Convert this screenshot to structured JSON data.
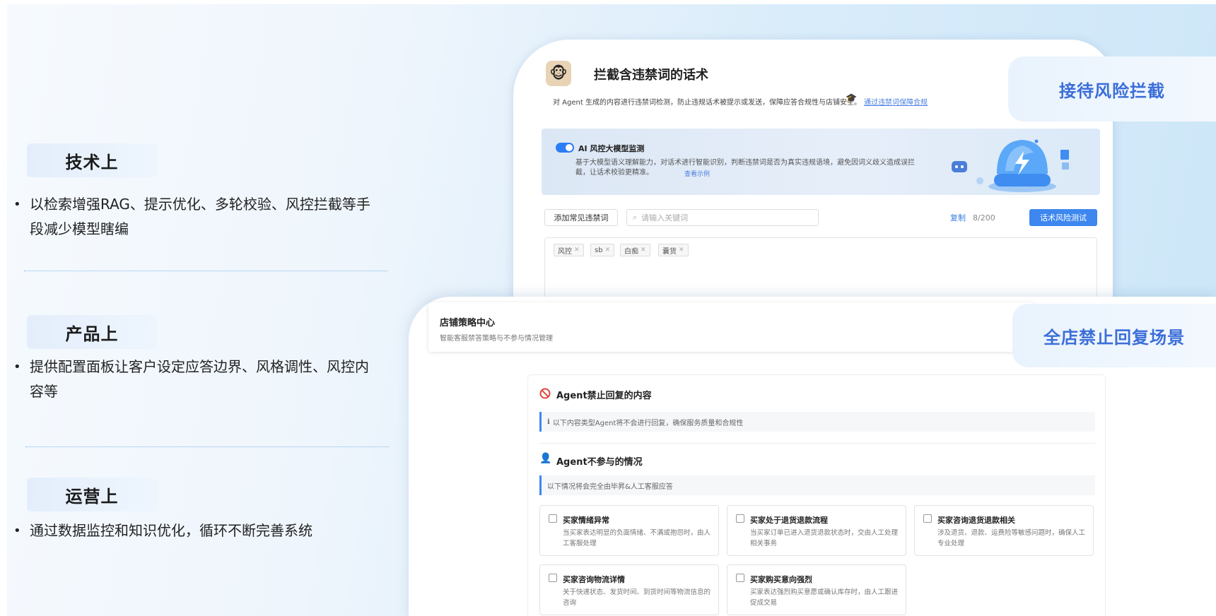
{
  "left": {
    "sections": [
      {
        "title": "技术上",
        "bullet": "以检索增强RAG、提示优化、多轮校验、风控拦截等手段减少模型瞎编"
      },
      {
        "title": "产品上",
        "bullet": "提供配置面板让客户设定应答边界、风格调性、风控内容等"
      },
      {
        "title": "运营上",
        "bullet": "通过数据监控和知识优化，循环不断完善系统"
      }
    ]
  },
  "card1": {
    "avatar_icon": "monkey-avatar",
    "title": "拦截含违禁词的话术",
    "desc": "对 Agent 生成的内容进行违禁词检测，防止违规话术被提示或发送，保障应答合规性与店铺安全。",
    "link": "通过违禁词保障合规",
    "banner": {
      "title": "AI 风控大模型监测",
      "text": "基于大模型语义理解能力，对话术进行智能识别，判断违禁词是否为真实违规语境，避免因词义歧义造成误拦截，让话术校验更精准。",
      "link": "查看示例"
    },
    "toolbar": {
      "add_btn": "添加常见违禁词",
      "search_placeholder": "请输入关键词",
      "copy": "复制",
      "count": "8/200",
      "test_btn": "话术风险测试"
    },
    "tags": [
      "风控",
      "sb",
      "白痴",
      "囊货"
    ]
  },
  "pills": {
    "top": "接待风险拦截",
    "bottom": "全店禁止回复场景"
  },
  "card2": {
    "head_title": "店铺策略中心",
    "head_sub": "智能客服禁答策略与不参与情况管理",
    "section1": {
      "title": "Agent禁止回复的内容",
      "note": "以下内容类型Agent将不会进行回复，确保服务质量和合规性"
    },
    "section2": {
      "title": "Agent不参与的情况",
      "note": "以下情况将会完全由毕昇&人工客服应答"
    },
    "options": [
      {
        "title": "买家情绪异常",
        "desc": "当买家表达明显的负面情绪、不满或抱怨时，由人工客服处理"
      },
      {
        "title": "买家处于退货退款流程",
        "desc": "当买家订单已进入退货退款状态时，交由人工处理相关事务"
      },
      {
        "title": "买家咨询退货退款相关",
        "desc": "涉及退货、退款、运费险等敏感问题时，确保人工专业处理"
      },
      {
        "title": "买家咨询物流详情",
        "desc": "关于快递状态、发货时间、到货时间等物流信息的咨询"
      },
      {
        "title": "买家购买意向强烈",
        "desc": "买家表达强烈购买意愿或确认库存时，由人工跟进促成交易"
      }
    ]
  },
  "colors": {
    "accent": "#3d87ef",
    "pill_text": "#3c6ed8",
    "forbid_red": "#e0463c"
  }
}
